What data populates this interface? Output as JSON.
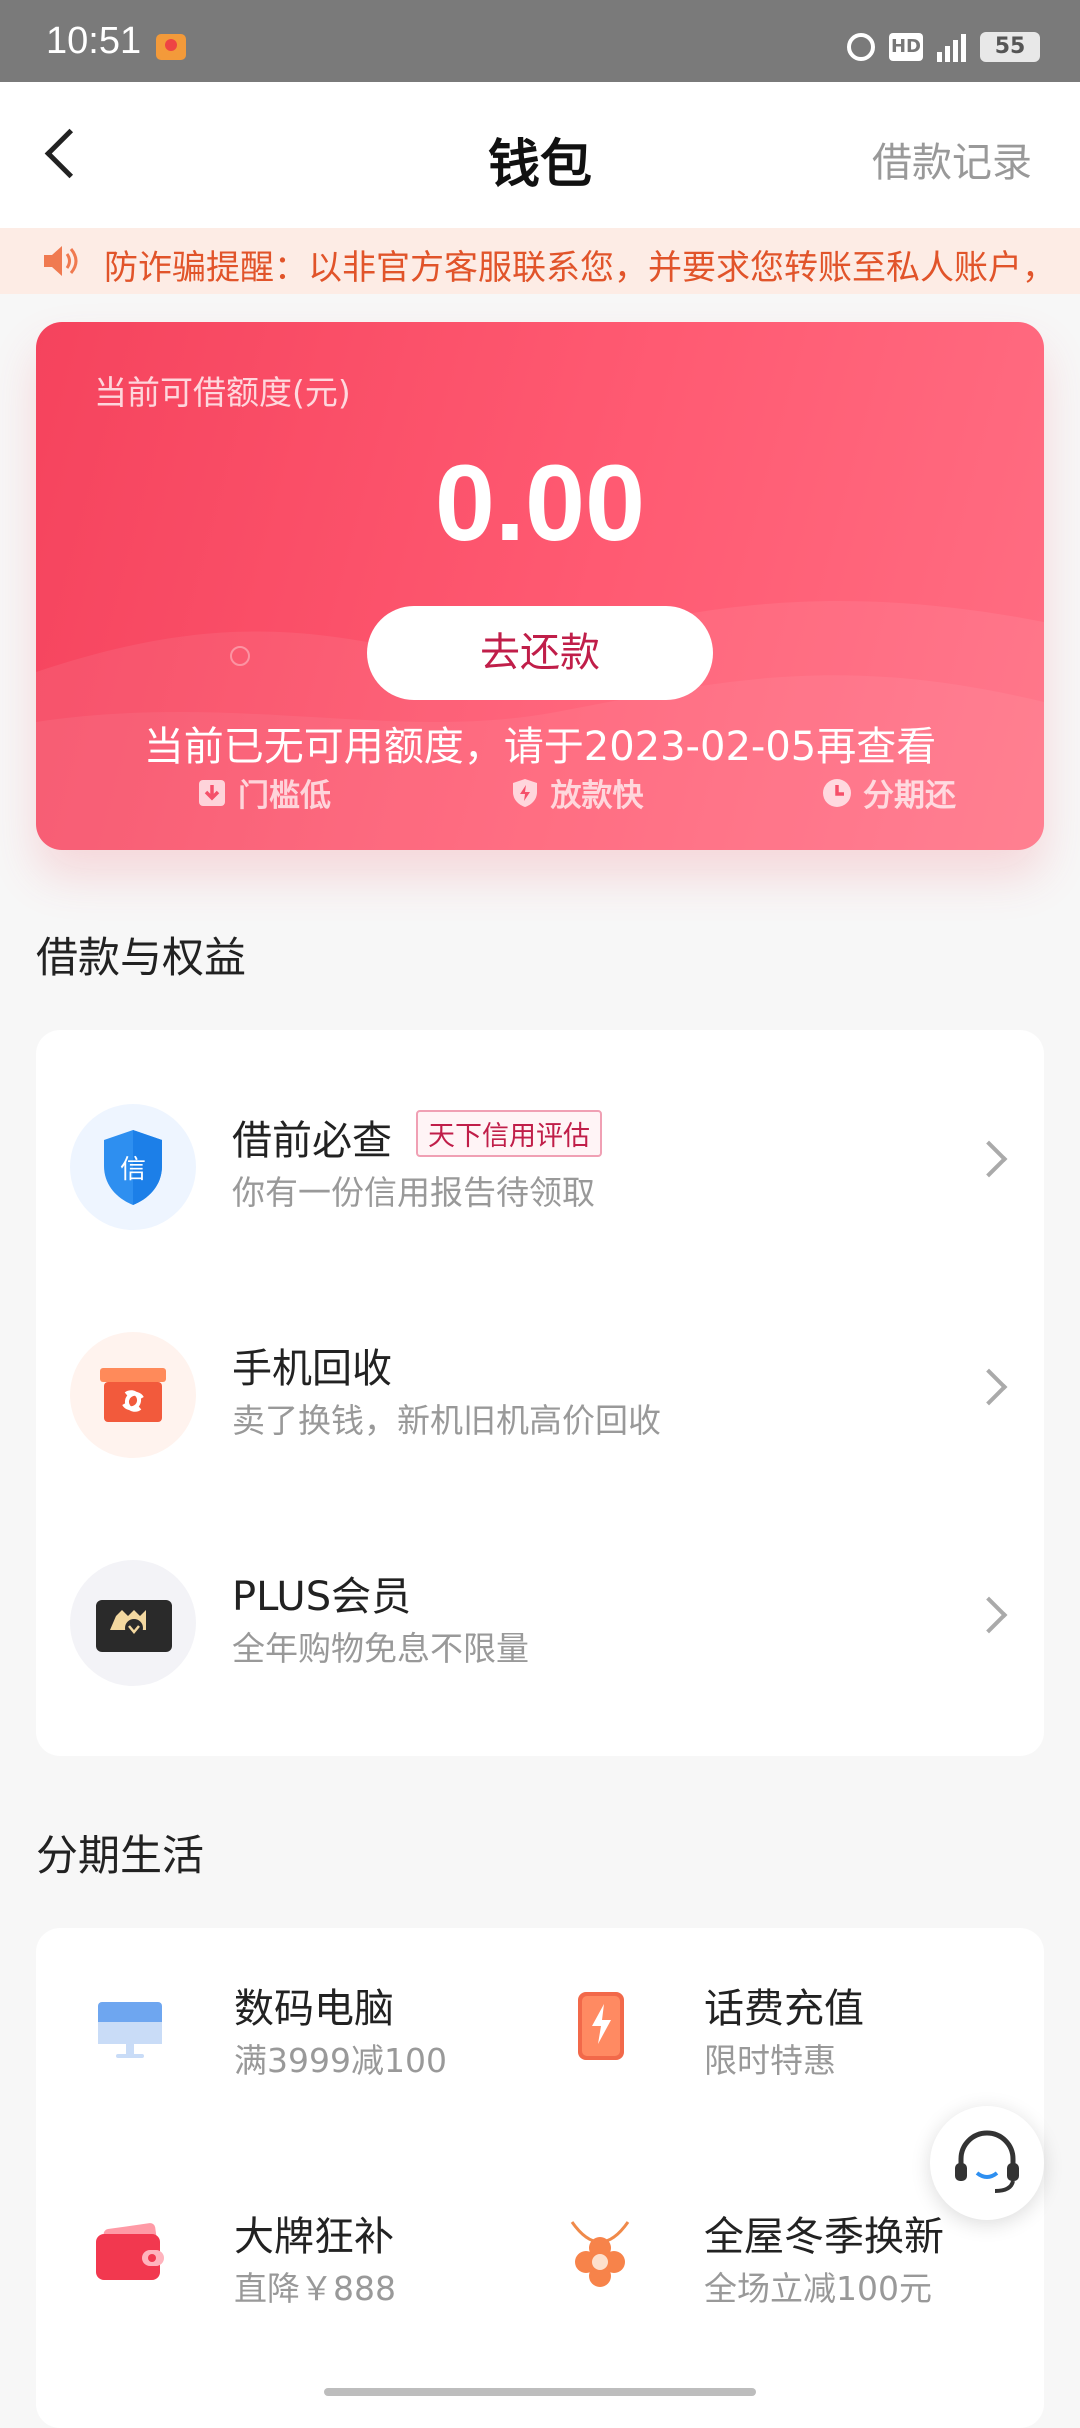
{
  "status_bar": {
    "time": "10:51",
    "hd": "HD",
    "battery": "55"
  },
  "header": {
    "title": "钱包",
    "right_link": "借款记录"
  },
  "notice": {
    "text": "防诈骗提醒：以非官方客服联系您，并要求您转账至私人账户，"
  },
  "credit": {
    "label": "当前可借额度(元)",
    "amount": "0.00",
    "repay_button": "去还款",
    "note": "当前已无可用额度，请于2023-02-05再查看",
    "features": [
      "门槛低",
      "放款快",
      "分期还"
    ]
  },
  "benefits_section": {
    "title": "借款与权益",
    "items": [
      {
        "title": "借前必查",
        "tag": "天下信用评估",
        "subtitle": "你有一份信用报告待领取",
        "icon": "credit-shield-icon",
        "icon_glyph": "信"
      },
      {
        "title": "手机回收",
        "tag": "",
        "subtitle": "卖了换钱，新机旧机高价回收",
        "icon": "recycle-box-icon"
      },
      {
        "title": "PLUS会员",
        "tag": "",
        "subtitle": "全年购物免息不限量",
        "icon": "plus-member-card-icon"
      }
    ]
  },
  "installment_section": {
    "title": "分期生活",
    "items": [
      {
        "title": "数码电脑",
        "subtitle": "满3999减100",
        "icon": "monitor-icon"
      },
      {
        "title": "话费充值",
        "subtitle": "限时特惠",
        "icon": "phone-charge-icon"
      },
      {
        "title": "大牌狂补",
        "subtitle": "直降￥888",
        "icon": "wallet-icon"
      },
      {
        "title": "全屋冬季换新",
        "subtitle": "全场立减100元",
        "icon": "necklace-flower-icon"
      }
    ]
  },
  "colors": {
    "accent": "#f5435d",
    "notice_text": "#e1542a",
    "repay_text": "#c01e49"
  }
}
